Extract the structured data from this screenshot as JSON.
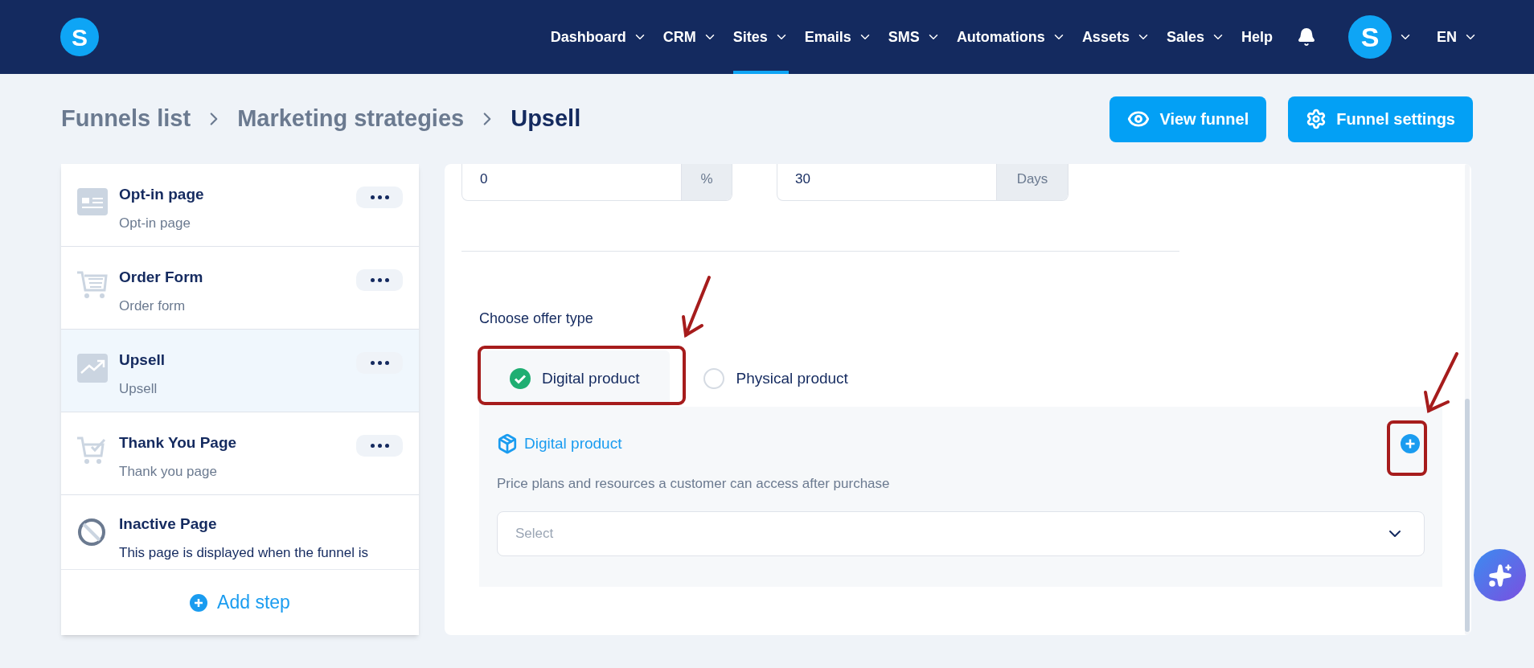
{
  "header": {
    "logo": "S",
    "nav": [
      {
        "label": "Dashboard",
        "caret": true,
        "selected": false
      },
      {
        "label": "CRM",
        "caret": true,
        "selected": false
      },
      {
        "label": "Sites",
        "caret": true,
        "selected": true
      },
      {
        "label": "Emails",
        "caret": true,
        "selected": false
      },
      {
        "label": "SMS",
        "caret": true,
        "selected": false
      },
      {
        "label": "Automations",
        "caret": true,
        "selected": false
      },
      {
        "label": "Assets",
        "caret": true,
        "selected": false
      },
      {
        "label": "Sales",
        "caret": true,
        "selected": false
      },
      {
        "label": "Help",
        "caret": false,
        "selected": false
      }
    ],
    "avatar": "S",
    "language": "EN"
  },
  "breadcrumb": [
    {
      "label": "Funnels list",
      "current": false
    },
    {
      "label": "Marketing strategies",
      "current": false
    },
    {
      "label": "Upsell",
      "current": true
    }
  ],
  "actions": [
    {
      "label": "View funnel",
      "kind": "eye"
    },
    {
      "label": "Funnel settings",
      "kind": "gear"
    }
  ],
  "steps": [
    {
      "title": "Opt-in page",
      "subtitle": "Opt-in page",
      "kind": "optin",
      "selected": false
    },
    {
      "title": "Order Form",
      "subtitle": "Order form",
      "kind": "order",
      "selected": false
    },
    {
      "title": "Upsell",
      "subtitle": "Upsell",
      "kind": "upsell",
      "selected": true
    },
    {
      "title": "Thank You Page",
      "subtitle": "Thank you page",
      "kind": "thanks",
      "selected": false
    },
    {
      "title": "Inactive Page",
      "subtitle": "This page is displayed when the funnel is",
      "kind": "inactive",
      "selected": false
    }
  ],
  "add_step": "Add step",
  "form": {
    "fields": [
      {
        "value": "0",
        "addon": "%"
      },
      {
        "value": "30",
        "addon": "Days"
      }
    ],
    "offer_label": "Choose offer type",
    "offer_options": [
      {
        "label": "Digital product",
        "selected": true
      },
      {
        "label": "Physical product",
        "selected": false
      }
    ],
    "product": {
      "title": "Digital product",
      "description": "Price plans and resources a customer can access after purchase",
      "select": {
        "placeholder": "Select"
      }
    }
  }
}
